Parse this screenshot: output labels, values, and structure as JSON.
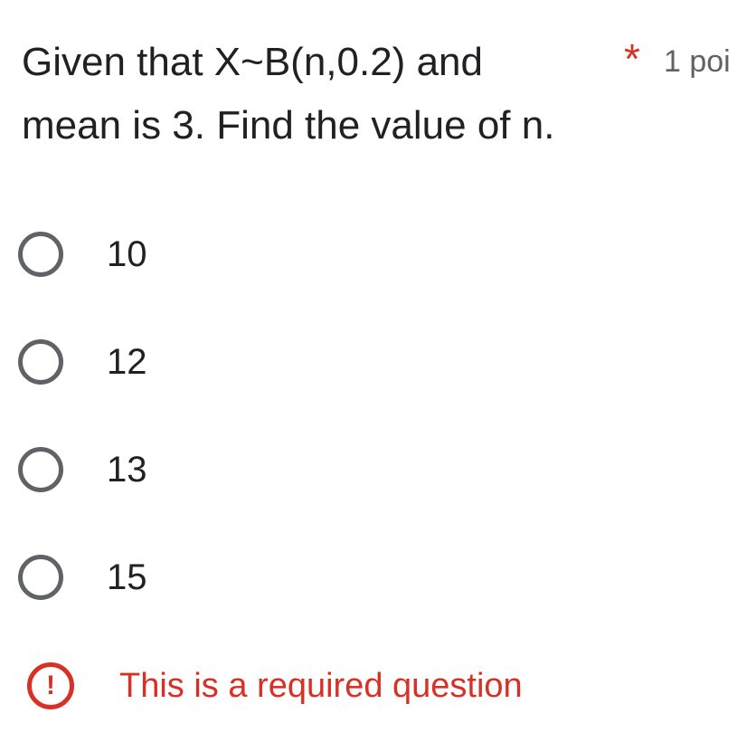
{
  "question": {
    "line1": "Given that X~B(n,0.2) and",
    "line2": "mean is 3. Find the value of n.",
    "required_marker": "*",
    "points": "1 poi"
  },
  "options": [
    {
      "label": "10",
      "selected": false
    },
    {
      "label": "12",
      "selected": false
    },
    {
      "label": "13",
      "selected": false
    },
    {
      "label": "15",
      "selected": false
    }
  ],
  "validation": {
    "icon": "error-exclamation-icon",
    "icon_glyph": "!",
    "message": "This is a required question"
  },
  "colors": {
    "text": "#202124",
    "radio_border": "#5f6368",
    "error": "#d93025"
  }
}
